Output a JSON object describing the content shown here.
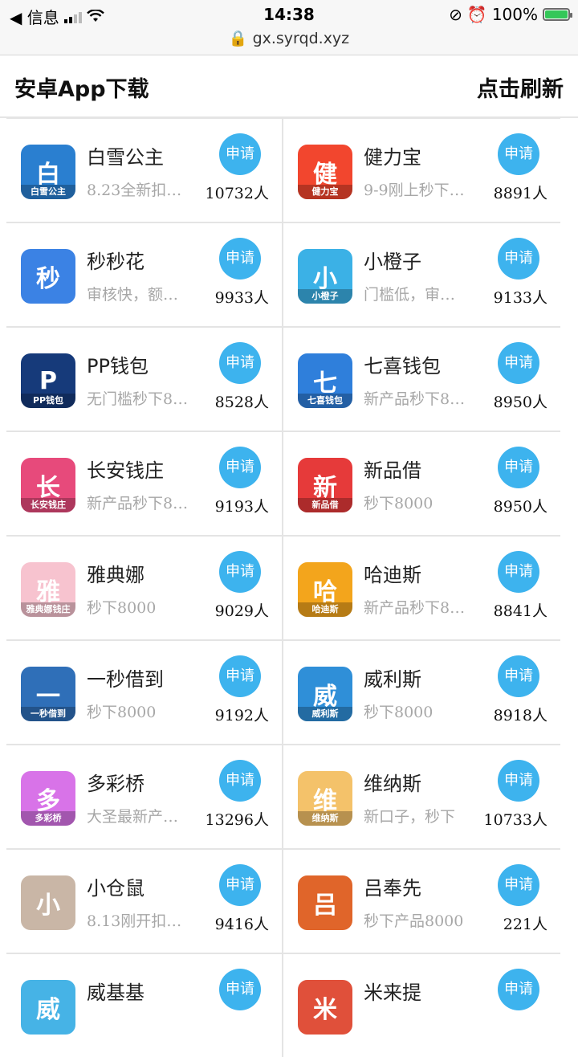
{
  "status_bar": {
    "back_label": "◀ 信息",
    "time": "14:38",
    "battery": "100%",
    "url": "gx.syrqd.xyz"
  },
  "header": {
    "title": "安卓App下载",
    "refresh": "点击刷新"
  },
  "apply_label": "申请",
  "items": [
    {
      "name": "白雪公主",
      "desc": "8.23全新扣…",
      "count": "10732人",
      "icon": "snow-white-app-icon",
      "color": "#2a7fd0",
      "caption": "白雪公主"
    },
    {
      "name": "健力宝",
      "desc": "9-9刚上秒下…",
      "count": "8891人",
      "icon": "jianlibao-app-icon",
      "color": "#f2462e",
      "caption": "健力宝"
    },
    {
      "name": "秒秒花",
      "desc": "审核快，额…",
      "count": "9933人",
      "icon": "stopwatch-app-icon",
      "color": "#3b82e4",
      "caption": ""
    },
    {
      "name": "小橙子",
      "desc": "门槛低，审…",
      "count": "9133人",
      "icon": "orange-app-icon",
      "color": "#3bb1e6",
      "caption": "小橙子"
    },
    {
      "name": "PP钱包",
      "desc": "无门槛秒下8…",
      "count": "8528人",
      "icon": "pp-wallet-app-icon",
      "color": "#163a7a",
      "caption": "PP钱包"
    },
    {
      "name": "七喜钱包",
      "desc": "新产品秒下8…",
      "count": "8950人",
      "icon": "qixi-wallet-app-icon",
      "color": "#2f7fdb",
      "caption": "七喜钱包"
    },
    {
      "name": "长安钱庄",
      "desc": "新产品秒下8…",
      "count": "9193人",
      "icon": "changan-app-icon",
      "color": "#e74a7b",
      "caption": "长安钱庄"
    },
    {
      "name": "新品借",
      "desc": "秒下8000",
      "count": "8950人",
      "icon": "xinpinjie-app-icon",
      "color": "#e63a3a",
      "caption": "新品借"
    },
    {
      "name": "雅典娜",
      "desc": "秒下8000",
      "count": "9029人",
      "icon": "athena-app-icon",
      "color": "#f7c3cf",
      "caption": "雅典娜钱庄"
    },
    {
      "name": "哈迪斯",
      "desc": "新产品秒下8…",
      "count": "8841人",
      "icon": "hades-app-icon",
      "color": "#f3a51c",
      "caption": "哈迪斯"
    },
    {
      "name": "一秒借到",
      "desc": "秒下8000",
      "count": "9192人",
      "icon": "rocket-app-icon",
      "color": "#2f6fb8",
      "caption": "一秒借到"
    },
    {
      "name": "威利斯",
      "desc": "秒下8000",
      "count": "8918人",
      "icon": "venice-app-icon",
      "color": "#2f8fd8",
      "caption": "威利斯"
    },
    {
      "name": "多彩桥",
      "desc": "大圣最新产…",
      "count": "13296人",
      "icon": "rainbow-bridge-app-icon",
      "color": "#d873e8",
      "caption": "多彩桥"
    },
    {
      "name": "维纳斯",
      "desc": "新口子，秒下",
      "count": "10733人",
      "icon": "venus-app-icon",
      "color": "#f4c26a",
      "caption": "维纳斯"
    },
    {
      "name": "小仓鼠",
      "desc": "8.13刚开扣…",
      "count": "9416人",
      "icon": "hamster-app-icon",
      "color": "#c9b6a6",
      "caption": ""
    },
    {
      "name": "吕奉先",
      "desc": "秒下产品8000",
      "count": "221人",
      "icon": "lvfengxian-app-icon",
      "color": "#e0652a",
      "caption": ""
    },
    {
      "name": "威基基",
      "desc": "",
      "count": "",
      "icon": "pig-app-icon",
      "color": "#46b3e6",
      "caption": ""
    },
    {
      "name": "米来提",
      "desc": "",
      "count": "",
      "icon": "mouse-app-icon",
      "color": "#e0503a",
      "caption": ""
    }
  ]
}
